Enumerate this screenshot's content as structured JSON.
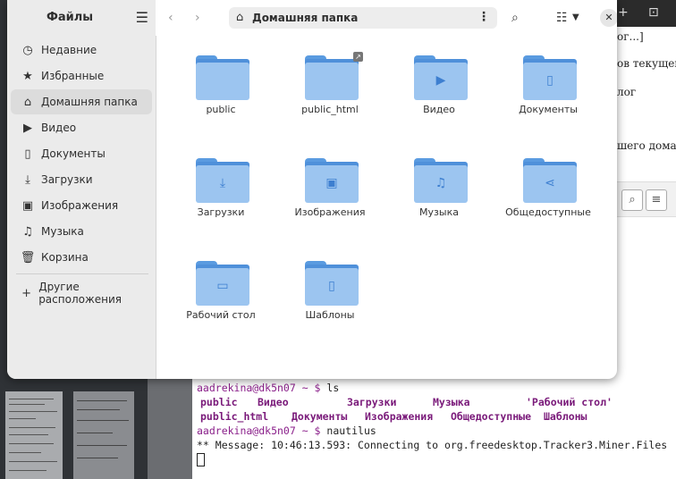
{
  "sidebar": {
    "title": "Файлы",
    "items": [
      {
        "label": "Недавние",
        "icon": "clock-icon",
        "glyph": "◷"
      },
      {
        "label": "Избранные",
        "icon": "star-icon",
        "glyph": "★"
      },
      {
        "label": "Домашняя папка",
        "icon": "home-icon",
        "glyph": "⌂",
        "active": true
      },
      {
        "label": "Видео",
        "icon": "video-icon",
        "glyph": "▶"
      },
      {
        "label": "Документы",
        "icon": "document-icon",
        "glyph": "▯"
      },
      {
        "label": "Загрузки",
        "icon": "download-icon",
        "glyph": "⤓"
      },
      {
        "label": "Изображения",
        "icon": "image-icon",
        "glyph": "▣"
      },
      {
        "label": "Музыка",
        "icon": "music-icon",
        "glyph": "♫"
      },
      {
        "label": "Корзина",
        "icon": "trash-icon",
        "glyph": "🗑"
      }
    ],
    "other_locations": "Другие расположения"
  },
  "header": {
    "path": "Домашняя папка"
  },
  "files": [
    {
      "label": "public",
      "emblem": ""
    },
    {
      "label": "public_html",
      "emblem": "",
      "link": true
    },
    {
      "label": "Видео",
      "emblem": "▶"
    },
    {
      "label": "Документы",
      "emblem": "▯"
    },
    {
      "label": "Загрузки",
      "emblem": "⤓"
    },
    {
      "label": "Изображения",
      "emblem": "▣"
    },
    {
      "label": "Музыка",
      "emblem": "♫"
    },
    {
      "label": "Общедоступные",
      "emblem": "⋖"
    },
    {
      "label": "Рабочий стол",
      "emblem": "▭"
    },
    {
      "label": "Шаблоны",
      "emblem": "▯"
    }
  ],
  "terminal": {
    "prompt1": "aadrekina@dk5n07 ~ $",
    "cmd1": " ls",
    "ls_row1": [
      "public",
      "Видео",
      "Загрузки",
      "Музыка",
      "'Рабочий стол'"
    ],
    "ls_row2": [
      "public_html",
      "Документы",
      "Изображения",
      "Общедоступные",
      "Шаблоны"
    ],
    "prompt2": "aadrekina@dk5n07 ~ $",
    "cmd2": " nautilus",
    "message": "** Message: 10:46:13.593: Connecting to org.freedesktop.Tracker3.Miner.Files"
  },
  "background_web": {
    "lines": [
      "ог...]",
      "ов текущего",
      "лог",
      "шего домаш"
    ]
  },
  "colors": {
    "folder_front": "#9cc5f0",
    "folder_back": "#4f90da",
    "prompt": "#8a1f8a",
    "sidebar_bg": "#ebebeb"
  }
}
